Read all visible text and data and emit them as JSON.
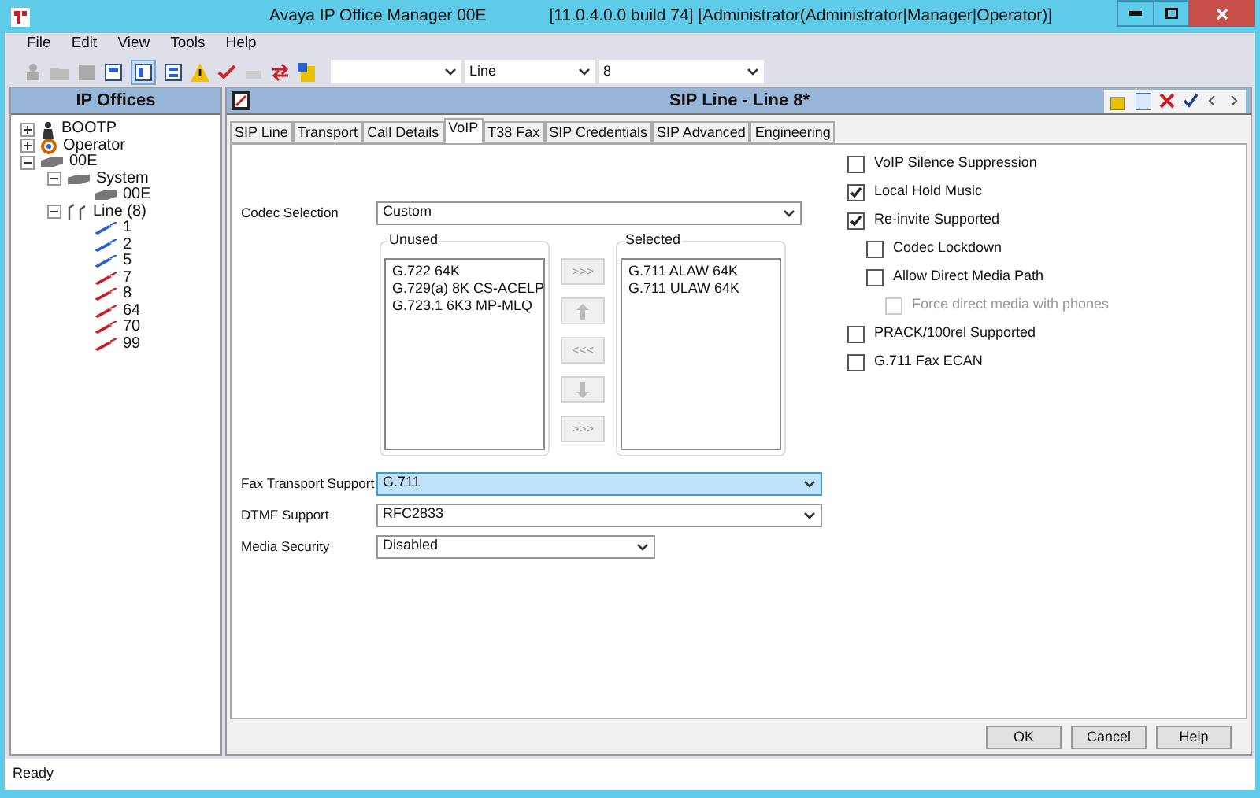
{
  "window": {
    "title": "Avaya IP Office Manager 00E",
    "info": "[11.0.4.0.0 build 74] [Administrator(Administrator|Manager|Operator)]"
  },
  "menu": [
    "File",
    "Edit",
    "View",
    "Tools",
    "Help"
  ],
  "toolbar": {
    "combos": [
      {
        "kind": "empty"
      },
      {
        "kind": "text",
        "value": "Line"
      },
      {
        "kind": "text",
        "value": "8"
      }
    ]
  },
  "sidebar": {
    "title": "IP Offices",
    "tree": [
      {
        "label": "BOOTP",
        "kind": "person",
        "expanded": false,
        "color": "#333333"
      },
      {
        "label": "Operator",
        "kind": "operator",
        "expanded": false,
        "color": "#cc6600"
      },
      {
        "label": "00E",
        "kind": "device",
        "expanded": true,
        "color": "#777777",
        "children": [
          {
            "label": "System",
            "kind": "device",
            "expanded": true,
            "color": "#777777",
            "children": [
              {
                "label": "00E",
                "kind": "device",
                "color": "#777777"
              }
            ]
          },
          {
            "label": "Line (8)",
            "kind": "lines",
            "expanded": true,
            "color": "#555555",
            "children": [
              {
                "label": "1",
                "kind": "line",
                "color": "#2a62c9"
              },
              {
                "label": "2",
                "kind": "line",
                "color": "#2a62c9"
              },
              {
                "label": "5",
                "kind": "line",
                "color": "#2a62c9"
              },
              {
                "label": "7",
                "kind": "line",
                "color": "#c8202a"
              },
              {
                "label": "8",
                "kind": "line",
                "color": "#c8202a"
              },
              {
                "label": "64",
                "kind": "line",
                "color": "#c8202a"
              },
              {
                "label": "70",
                "kind": "line",
                "color": "#c8202a"
              },
              {
                "label": "99",
                "kind": "line",
                "color": "#c8202a"
              }
            ]
          }
        ]
      }
    ]
  },
  "panel": {
    "title": "SIP Line - Line 8*"
  },
  "tabs": [
    {
      "label": "SIP Line",
      "selected": false
    },
    {
      "label": "Transport",
      "selected": false
    },
    {
      "label": "Call Details",
      "selected": false
    },
    {
      "label": "VoIP",
      "selected": true
    },
    {
      "label": "T38 Fax",
      "selected": false
    },
    {
      "label": "SIP Credentials",
      "selected": false
    },
    {
      "label": "SIP Advanced",
      "selected": false
    },
    {
      "label": "Engineering",
      "selected": false
    }
  ],
  "codec": {
    "label": "Codec Selection",
    "value": "Custom",
    "unused_title": "Unused",
    "unused": [
      "G.722 64K",
      "G.729(a) 8K CS-ACELP",
      "G.723.1 6K3 MP-MLQ"
    ],
    "selected_title": "Selected",
    "selected": [
      "G.711 ALAW 64K",
      "G.711 ULAW 64K"
    ],
    "buttons": [
      {
        "kind": "text",
        "label": ">>>"
      },
      {
        "kind": "up"
      },
      {
        "kind": "text",
        "label": "<<<"
      },
      {
        "kind": "down"
      },
      {
        "kind": "text",
        "label": ">>>"
      }
    ]
  },
  "fields": [
    {
      "label": "Fax Transport Support",
      "value": "G.711",
      "focused": true,
      "kind": "wide"
    },
    {
      "label": "DTMF Support",
      "value": "RFC2833",
      "focused": false,
      "kind": "wide"
    },
    {
      "label": "Media Security",
      "value": "Disabled",
      "focused": false,
      "kind": "narrow"
    }
  ],
  "options": [
    {
      "label": "VoIP Silence Suppression",
      "checked": false,
      "disabled": false
    },
    {
      "label": "Local Hold Music",
      "checked": true,
      "disabled": false
    },
    {
      "label": "Re-invite Supported",
      "checked": true,
      "disabled": false,
      "children": [
        {
          "label": "Codec Lockdown",
          "checked": false,
          "disabled": false
        },
        {
          "label": "Allow Direct Media Path",
          "checked": false,
          "disabled": false,
          "children": [
            {
              "label": "Force direct media with phones",
              "checked": false,
              "disabled": true
            }
          ]
        }
      ]
    },
    {
      "label": "PRACK/100rel Supported",
      "checked": false,
      "disabled": false
    },
    {
      "label": "G.711 Fax ECAN",
      "checked": false,
      "disabled": false
    }
  ],
  "buttons": [
    "OK",
    "Cancel",
    "Help"
  ],
  "status_bar": "Ready"
}
